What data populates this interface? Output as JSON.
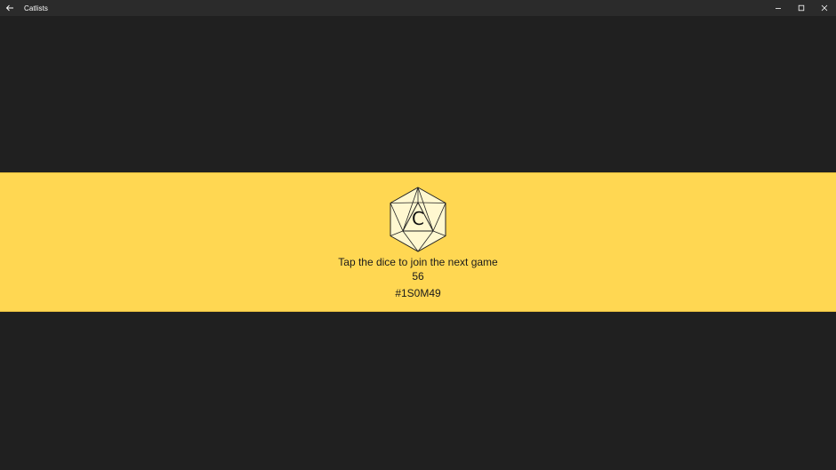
{
  "window": {
    "title": "Catlists",
    "back_icon": "back-arrow-icon",
    "minimize_icon": "minimize-icon",
    "maximize_icon": "maximize-icon",
    "close_icon": "close-icon"
  },
  "colors": {
    "background": "#202020",
    "titlebar": "#2b2b2b",
    "banner": "#ffd752",
    "dice_fill": "#fff8d0",
    "dice_stroke": "#222222"
  },
  "game": {
    "dice_icon": "d20-icon",
    "dice_letter": "C",
    "prompt": "Tap the dice to join the next game",
    "count": "56",
    "game_code": "#1S0M49"
  }
}
